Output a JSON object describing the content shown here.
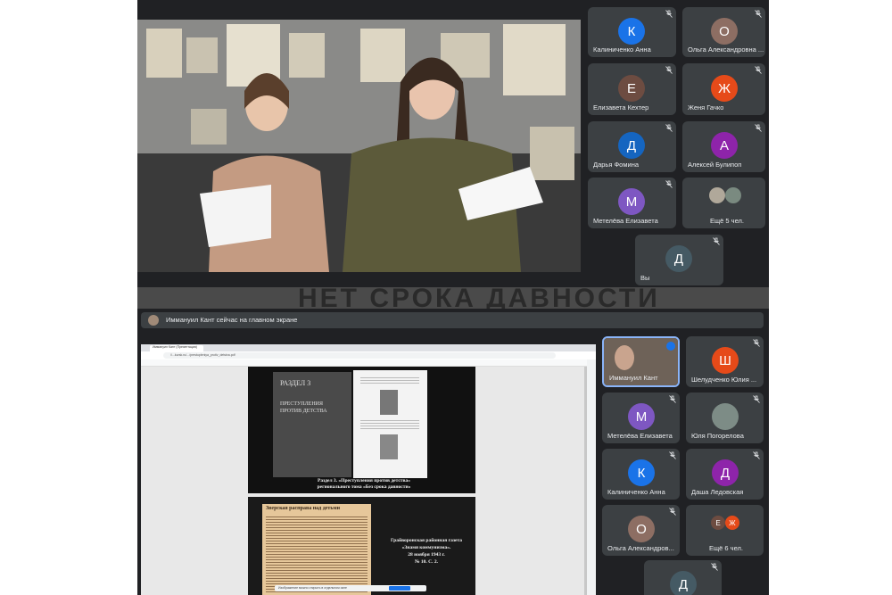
{
  "top_call": {
    "participants": [
      {
        "initial": "К",
        "name": "Калиниченко Анна",
        "color": "#1a73e8"
      },
      {
        "initial": "О",
        "name": "Ольга Александровна ...",
        "color": "#8d6e63"
      },
      {
        "initial": "Е",
        "name": "Елизавета Кехтер",
        "color": "#6d4c41"
      },
      {
        "initial": "Ж",
        "name": "Женя Гачко",
        "color": "#e64a19"
      },
      {
        "initial": "Д",
        "name": "Дарья Фомина",
        "color": "#1565c0"
      },
      {
        "initial": "А",
        "name": "Алексей Булипоп",
        "color": "#8e24aa"
      },
      {
        "initial": "М",
        "name": "Метелёва Елизавета",
        "color": "#7e57c2"
      },
      {
        "initial": "Д",
        "name": "Вы",
        "color": "#455a64"
      }
    ],
    "more_label": "Ещё 5 чел."
  },
  "banner": {
    "ribbon_text": "НЕТ СРОКА ДАВНОСТИ",
    "text": "Иммануил Кант сейчас на главном экране"
  },
  "bottom_call": {
    "presenter_name": "Иммануил Кант",
    "participants": [
      {
        "initial": "Ш",
        "name": "Шелудченко Юлия ...",
        "color": "#e64a19"
      },
      {
        "initial": "М",
        "name": "Метелёва Елизавета",
        "color": "#7e57c2"
      },
      {
        "initial": "",
        "name": "Юля Погорелова",
        "color": "#5f6368"
      },
      {
        "initial": "К",
        "name": "Калиниченко Анна",
        "color": "#1a73e8"
      },
      {
        "initial": "Д",
        "name": "Даша Ледовская",
        "color": "#8e24aa"
      },
      {
        "initial": "О",
        "name": "Ольга Александров...",
        "color": "#8d6e63"
      },
      {
        "initial": "Д",
        "name": "",
        "color": "#455a64"
      }
    ],
    "more_label": "Ещё 6 чел.",
    "more_initials": [
      "Е",
      "Ж"
    ]
  },
  "shared_screen": {
    "tab_title": "Иммануил Кант (Презентация)",
    "url": "//...kursk.ru/.../prestupleniya_protiv_detstva.pdf",
    "slide1": {
      "section": "РАЗДЕЛ 3",
      "title": "ПРЕСТУПЛЕНИЯ ПРОТИВ ДЕТСТВА",
      "caption": "Раздел 3. «Преступления против детства» регионального тома «Без срока давности»"
    },
    "slide2": {
      "clipping_header": "Зверская расправа над детьми",
      "caption_line1": "Грайворонская районная газета",
      "caption_line2": "«Знамя коммунизма».",
      "caption_line3": "28 ноября 1943 г.",
      "caption_line4": "№ 10. С. 2."
    },
    "status_bar": "Изображение можно открыть в отдельном окне"
  }
}
